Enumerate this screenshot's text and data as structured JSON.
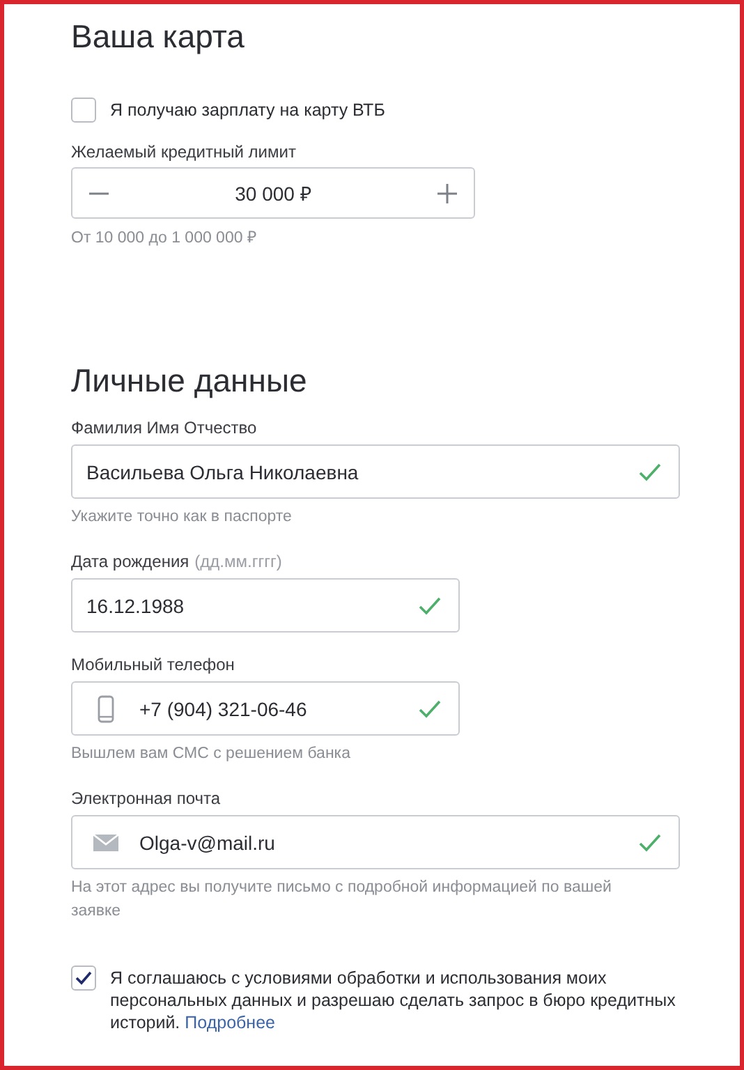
{
  "sections": [
    {
      "title": "Ваша карта",
      "items": [
        {
          "kind": "checkbox",
          "label": "Я получаю зарплату на карту ВТБ",
          "checked": false
        },
        {
          "kind": "stepper",
          "label": "Желаемый кредитный лимит",
          "value": "30 000 ₽",
          "hint": "От 10 000 до 1 000 000 ₽"
        }
      ]
    },
    {
      "title": "Личные данные",
      "items": [
        {
          "kind": "name",
          "label": "Фамилия Имя Отчество",
          "value": "Васильева Ольга Николаевна",
          "valid": true,
          "hint": "Укажите точно как в паспорте"
        },
        {
          "kind": "date",
          "label": "Дата рождения",
          "format": "(дд.мм.гггг)",
          "value": "16.12.1988",
          "valid": true
        },
        {
          "kind": "phone",
          "label": "Мобильный телефон",
          "value": "+7 (904) 321-06-46",
          "valid": true,
          "hint": "Вышлем вам СМС с решением банка"
        },
        {
          "kind": "email",
          "label": "Электронная почта",
          "value": "Olga-v@mail.ru",
          "valid": true,
          "hint": "На этот адрес вы получите письмо с подробной информацией по вашей заявке"
        }
      ]
    }
  ],
  "consent": {
    "checked": true,
    "text": "Я соглашаюсь с условиями обработки и использования моих персональных данных и разрешаю сделать запрос в бюро кредитных историй.",
    "link": "Подробнее"
  }
}
